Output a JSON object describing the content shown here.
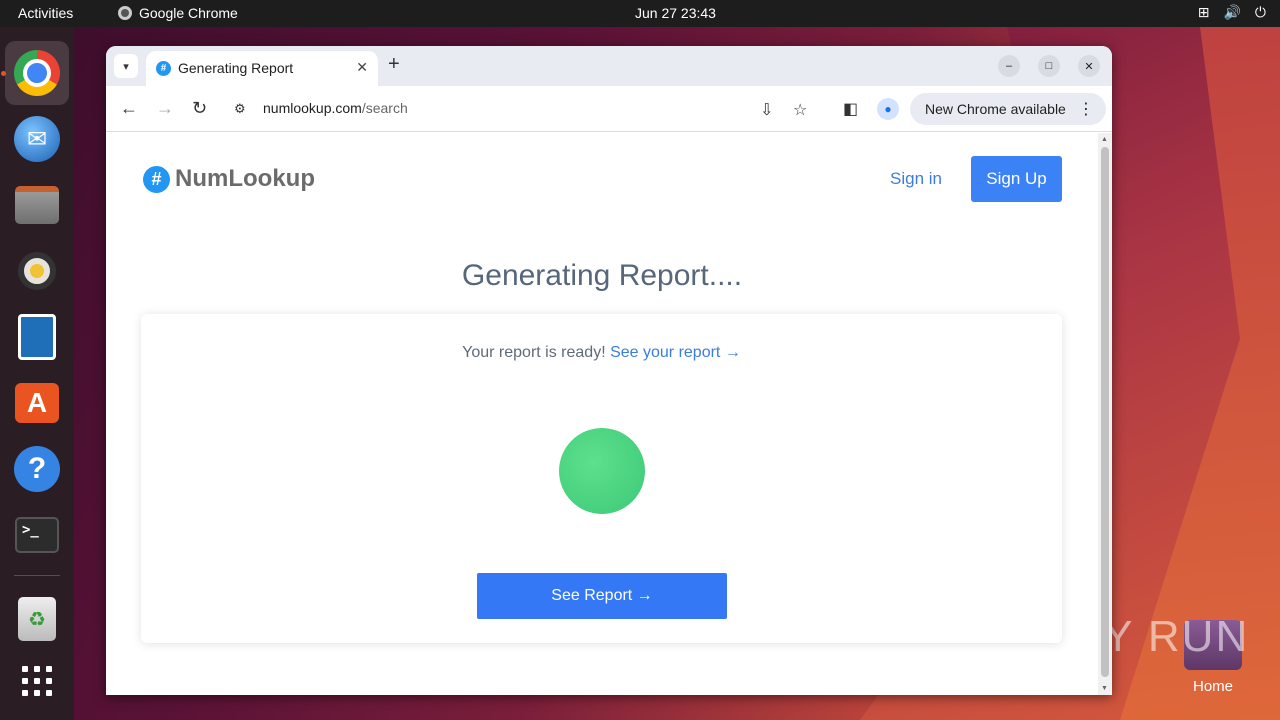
{
  "topbar": {
    "activities": "Activities",
    "app_name": "Google Chrome",
    "clock": "Jun 27  23:43"
  },
  "dock": {
    "items": [
      "chrome-icon",
      "thunderbird-icon",
      "files-icon",
      "rhythmbox-icon",
      "writer-icon",
      "app-center-icon",
      "help-icon",
      "terminal-icon",
      "trash-icon",
      "show-apps-icon"
    ]
  },
  "desktop": {
    "home_label": "Home",
    "watermark": "ANY RUN"
  },
  "browser": {
    "tab_title": "Generating Report",
    "url_host": "numlookup.com",
    "url_path": "/search",
    "update_chip": "New Chrome available"
  },
  "page": {
    "logo_text": "NumLookup",
    "logo_mark": "#",
    "sign_in": "Sign in",
    "sign_up": "Sign Up",
    "heading": "Generating Report....",
    "ready_text": "Your report is ready!",
    "ready_link": "See your report →",
    "see_report_button": "See Report →"
  },
  "colors": {
    "accent_blue": "#3b82f6",
    "link_blue": "#3b7ddd",
    "status_green": "#4ade80"
  }
}
